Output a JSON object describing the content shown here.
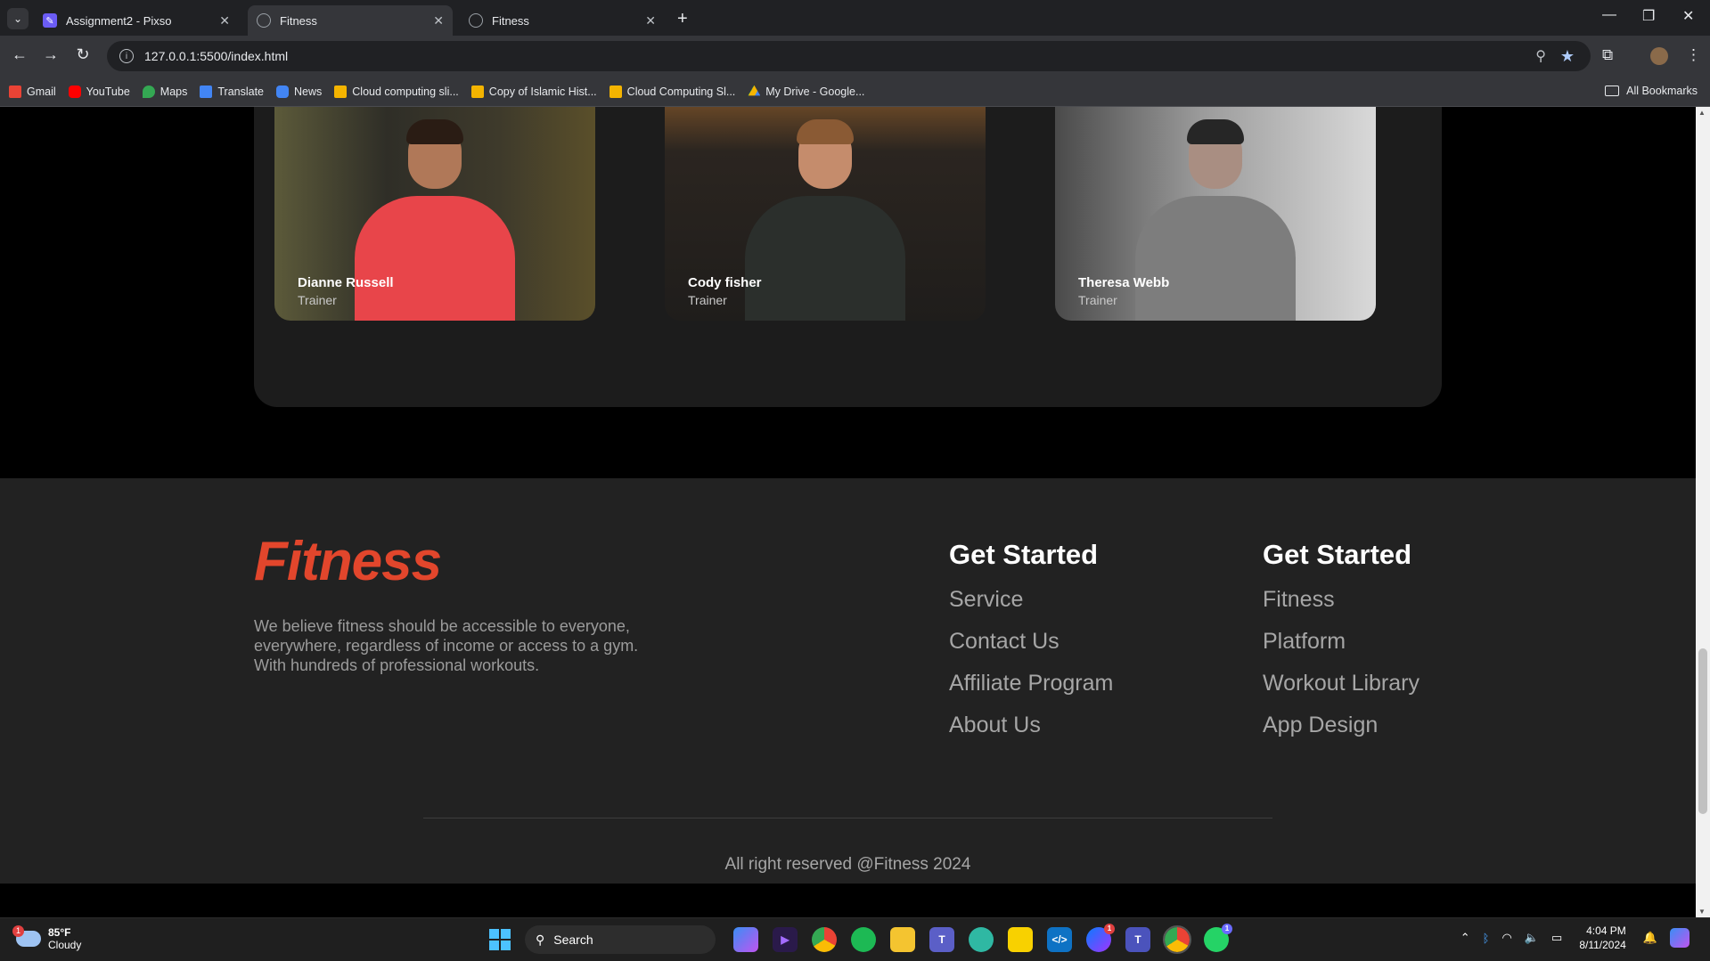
{
  "browser": {
    "tabs": [
      {
        "title": "Assignment2 - Pixso",
        "favicon_color": "#6b5cf5"
      },
      {
        "title": "Fitness",
        "favicon_color": "#9aa0a6"
      },
      {
        "title": "Fitness",
        "favicon_color": "#9aa0a6"
      }
    ],
    "new_tab": "+",
    "url": "127.0.0.1:5500/index.html",
    "bookmarks": [
      {
        "label": "Gmail",
        "color": "#ea4335"
      },
      {
        "label": "YouTube",
        "color": "#ff0000"
      },
      {
        "label": "Maps",
        "color": "#34a853"
      },
      {
        "label": "Translate",
        "color": "#4285f4"
      },
      {
        "label": "News",
        "color": "#4285f4"
      },
      {
        "label": "Cloud computing sli...",
        "color": "#f4b400"
      },
      {
        "label": "Copy of Islamic Hist...",
        "color": "#f4b400"
      },
      {
        "label": "Cloud Computing Sl...",
        "color": "#f4b400"
      },
      {
        "label": "My Drive - Google...",
        "color": "#0f9d58"
      }
    ],
    "all_bookmarks": "All Bookmarks"
  },
  "trainers": [
    {
      "name": "Dianne Russell",
      "role": "Trainer",
      "shirt": "#e8454a",
      "bg": "#3a3a2e"
    },
    {
      "name": "Cody fisher",
      "role": "Trainer",
      "shirt": "#2b2f2c",
      "bg": "#3b2f22"
    },
    {
      "name": "Theresa Webb",
      "role": "Trainer",
      "shirt": "#7d7d7d",
      "bg": "#b9b9b9"
    }
  ],
  "footer": {
    "brand": "Fitness",
    "about": "We believe fitness should be accessible to everyone, everywhere, regardless of income or access to a gym. With hundreds of professional workouts.",
    "columns": [
      {
        "title": "Get Started",
        "links": [
          "Service",
          "Contact Us",
          "Affiliate Program",
          "About Us"
        ]
      },
      {
        "title": "Get Started",
        "links": [
          "Fitness",
          "Platform",
          "Workout Library",
          "App Design"
        ]
      }
    ],
    "copyright": "All right reserved @Fitness 2024",
    "brand_color": "#e2462c"
  },
  "taskbar": {
    "weather": {
      "temp": "85°F",
      "condition": "Cloudy",
      "badge": "1"
    },
    "search": "Search",
    "time": "4:04 PM",
    "date": "8/11/2024"
  }
}
